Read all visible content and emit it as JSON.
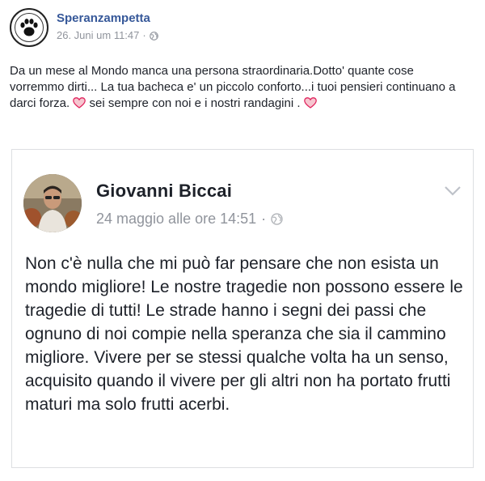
{
  "post": {
    "author": "Speranzampetta",
    "time": "26. Juni um 11:47",
    "text_part1": "Da un mese al Mondo manca una persona straordinaria.Dotto' quante cose vorremmo dirti... La tua bacheca e' un piccolo conforto...i tuoi pensieri continuano a darci forza. ",
    "text_part2": " sei sempre con noi e i nostri randagini . "
  },
  "shared_post": {
    "author": "Giovanni Biccai",
    "time": "24 maggio alle ore 14:51",
    "text": "Non c'è nulla che mi può far pensare che non esista un mondo migliore! Le nostre tragedie non possono essere le tragedie di tutti! Le strade hanno i segni dei passi che ognuno di noi compie nella speranza che sia il cammino migliore. Vivere per se stessi qualche volta ha un senso, acquisito quando il vivere per gli altri non ha portato frutti maturi ma solo frutti acerbi."
  },
  "colors": {
    "link": "#365899",
    "meta": "#90949c",
    "text": "#1d2129",
    "heart": "#e0245e",
    "border": "#dddfe2"
  },
  "icons": [
    "paw-logo-icon",
    "globe-icon",
    "heart-icon",
    "chevron-down-icon"
  ]
}
